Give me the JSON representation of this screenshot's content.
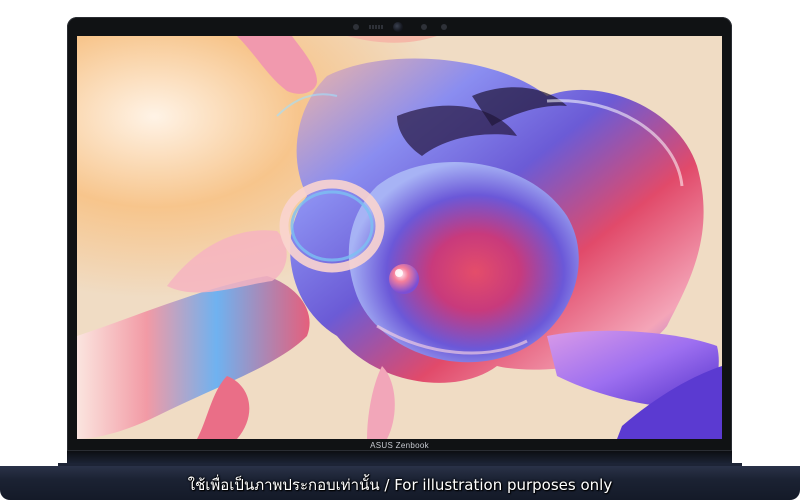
{
  "laptop": {
    "brand_label": "ASUS Zenbook",
    "colors": {
      "body": "#1b2233",
      "bezel": "#101214",
      "wallpaper_background": "#f0dcc4"
    }
  },
  "wallpaper": {
    "description_icon": "abstract-liquid-glass-icon"
  },
  "caption": {
    "text": "ใช้เพื่อเป็นภาพประกอบเท่านั้น / For illustration purposes only"
  }
}
